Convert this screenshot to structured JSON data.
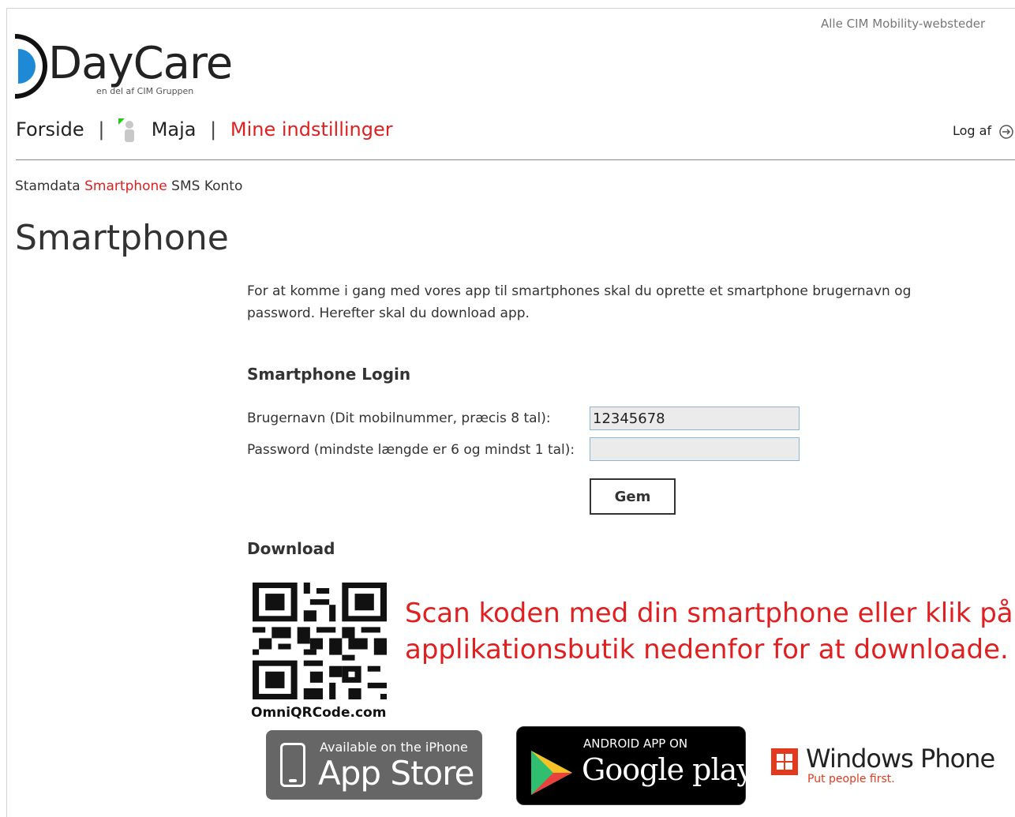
{
  "header": {
    "top_link": "Alle CIM Mobility-websteder",
    "logo_text": "DayCare",
    "logo_sub": "en del af CIM Gruppen"
  },
  "topnav": {
    "home": "Forside",
    "sep": "|",
    "user": "Maja",
    "settings": "Mine indstillinger",
    "logout": "Log af"
  },
  "subnav": {
    "items": [
      "Stamdata",
      "Smartphone",
      "SMS Konto"
    ],
    "active": "Smartphone"
  },
  "page": {
    "title": "Smartphone",
    "intro": "For at komme i gang med vores app til smartphones skal du oprette et smartphone brugernavn og password. Herefter skal du download app."
  },
  "login": {
    "heading": "Smartphone Login",
    "username_label": "Brugernavn (Dit mobilnummer, præcis 8 tal):",
    "username_value": "12345678",
    "password_label": "Password (mindste længde er 6 og mindst 1 tal):",
    "password_value": "",
    "save_label": "Gem"
  },
  "download": {
    "heading": "Download",
    "qr_caption": "OmniQRCode.com",
    "scan_line1": "Scan koden med din smartphone eller klik på din",
    "scan_line2": "applikationsbutik nedenfor for at downloade.",
    "appstore_small": "Available on the iPhone",
    "appstore_big": "App Store",
    "gplay_small": "ANDROID APP ON",
    "gplay_big": "Google play",
    "winphone_big": "Windows Phone",
    "winphone_small": "Put people first."
  },
  "colors": {
    "accent": "#e02020",
    "input_border": "#88b6d6",
    "input_bg": "#ebebeb"
  }
}
